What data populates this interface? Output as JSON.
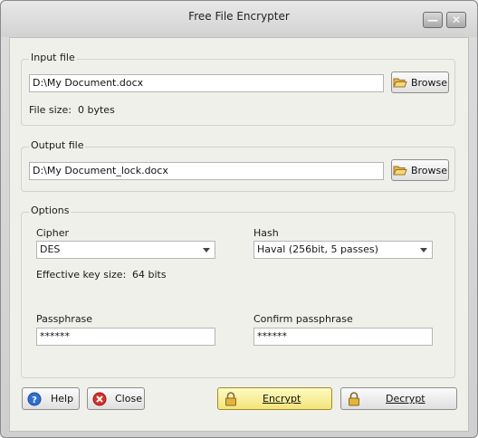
{
  "window": {
    "title": "Free File Encrypter",
    "minimize_glyph": "—",
    "close_glyph": "✕"
  },
  "input_file": {
    "group_label": "Input file",
    "path": "D:\\My Document.docx",
    "browse_label": "Browse",
    "size_label": "File size:",
    "size_value": "0 bytes"
  },
  "output_file": {
    "group_label": "Output file",
    "path": "D:\\My Document_lock.docx",
    "browse_label": "Browse"
  },
  "options": {
    "group_label": "Options",
    "cipher_label": "Cipher",
    "cipher_value": "DES",
    "hash_label": "Hash",
    "hash_value": "Haval (256bit, 5 passes)",
    "key_size_label": "Effective key size:",
    "key_size_value": "64 bits",
    "passphrase_label": "Passphrase",
    "passphrase_value": "******",
    "confirm_label": "Confirm passphrase",
    "confirm_value": "******"
  },
  "buttons": {
    "help": "Help",
    "close": "Close",
    "encrypt": "Encrypt",
    "decrypt": "Decrypt"
  },
  "icons": {
    "folder": "folder-open-icon",
    "help": "help-icon",
    "close": "close-circle-icon",
    "lock": "padlock-icon"
  },
  "colors": {
    "encrypt_button": "#f3e47a",
    "help_icon": "#2f6fd0",
    "close_icon": "#d9302a",
    "folder_icon": "#e6b84a"
  }
}
